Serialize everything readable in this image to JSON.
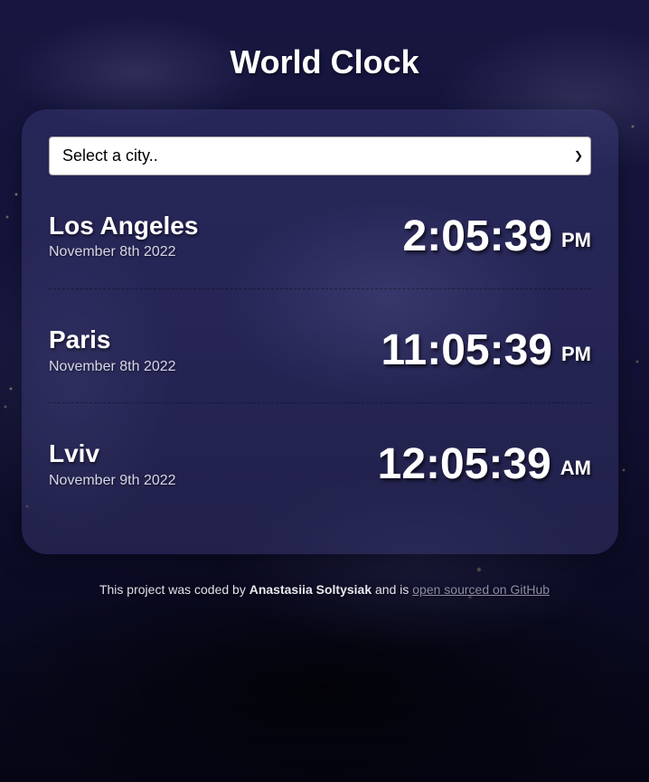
{
  "header": {
    "title": "World Clock"
  },
  "select": {
    "value": "Select a city..",
    "icon": "chevron-down-icon"
  },
  "cities": [
    {
      "name": "Los Angeles",
      "date": "November 8th 2022",
      "time": "2:05:39",
      "ampm": "PM"
    },
    {
      "name": "Paris",
      "date": "November 8th 2022",
      "time": "11:05:39",
      "ampm": "PM"
    },
    {
      "name": "Lviv",
      "date": "November 9th 2022",
      "time": "12:05:39",
      "ampm": "AM"
    }
  ],
  "footer": {
    "text_before": "This project was coded by ",
    "author": "Anastasiia Soltysiak",
    "text_middle": " and is ",
    "link_text": "open sourced on GitHub"
  },
  "colors": {
    "background": "#14133a",
    "card": "#3c3c78",
    "text": "#ffffff",
    "link": "#8d8da8"
  }
}
